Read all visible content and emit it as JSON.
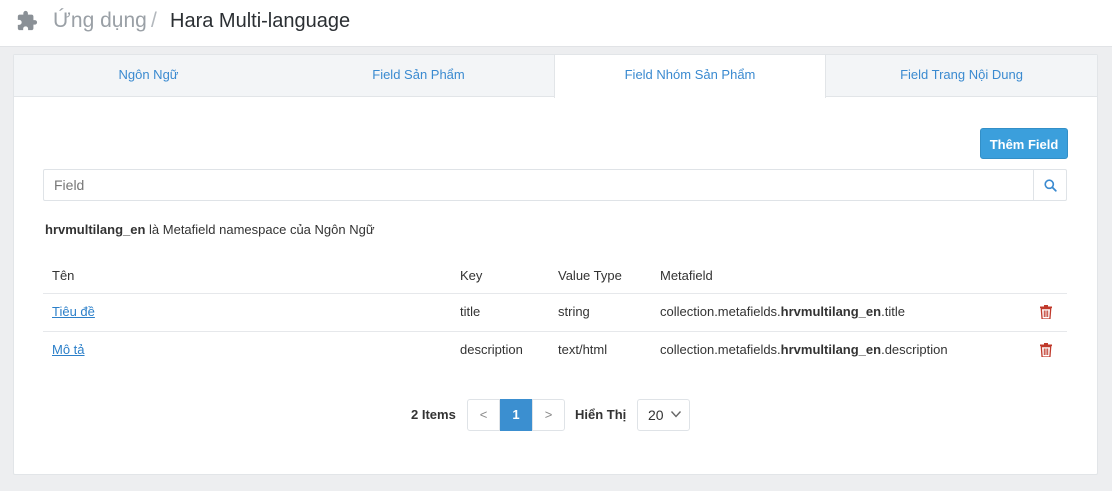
{
  "header": {
    "app_label": "Ứng dụng",
    "separator": "/",
    "current": "Hara Multi-language",
    "icon": "puzzle-icon"
  },
  "tabs": [
    {
      "label": "Ngôn Ngữ",
      "active": false
    },
    {
      "label": "Field Sản Phẩm",
      "active": false
    },
    {
      "label": "Field Nhóm Sản Phẩm",
      "active": true
    },
    {
      "label": "Field Trang Nội Dung",
      "active": false
    }
  ],
  "toolbar": {
    "add_label": "Thêm Field"
  },
  "search": {
    "placeholder": "Field",
    "value": "",
    "icon": "search-icon"
  },
  "note": {
    "namespace": "hrvmultilang_en",
    "text": " là Metafield namespace của Ngôn Ngữ"
  },
  "table": {
    "headers": {
      "name": "Tên",
      "key": "Key",
      "type": "Value Type",
      "metafield": "Metafield"
    },
    "rows": [
      {
        "name": "Tiêu đề",
        "key": "title",
        "type": "string",
        "mf_prefix": "collection.metafields.",
        "mf_ns": "hrvmultilang_en",
        "mf_suffix": ".title"
      },
      {
        "name": "Mô tả",
        "key": "description",
        "type": "text/html",
        "mf_prefix": "collection.metafields.",
        "mf_ns": "hrvmultilang_en",
        "mf_suffix": ".description"
      }
    ]
  },
  "pagination": {
    "count_label": "2 Items",
    "prev": "<",
    "current": "1",
    "next": ">",
    "show_label": "Hiển Thị",
    "page_size": "20"
  },
  "colors": {
    "accent": "#3b9fdc",
    "link": "#2b7fc9",
    "danger": "#c0392b"
  }
}
